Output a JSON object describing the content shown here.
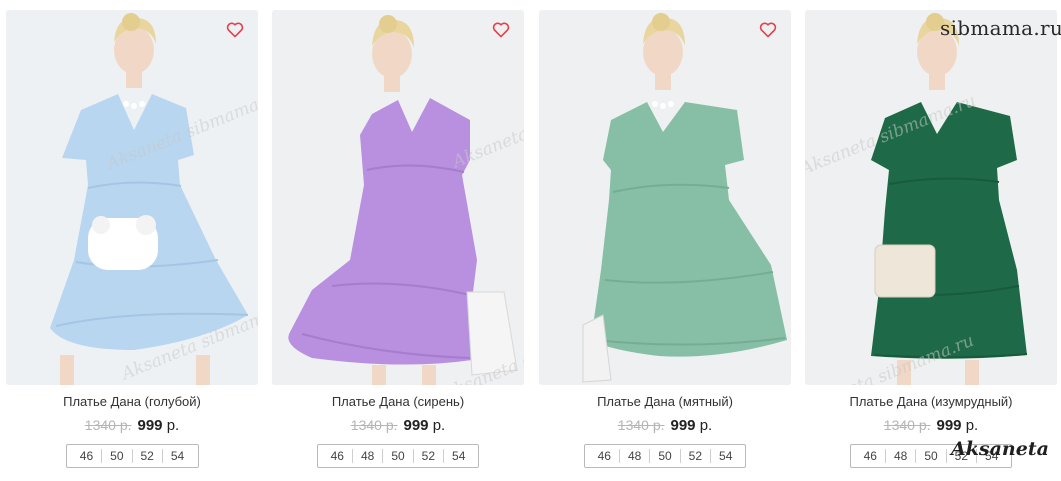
{
  "colors": {
    "heart": "#e2434b",
    "price_old": "#b5b5b5",
    "size_border": "#b9b9b9"
  },
  "watermarks": {
    "site": "sibmama.ru",
    "signature": "Aksaneta",
    "diagonal": "Aksaneta sibmama.ru"
  },
  "products": [
    {
      "title": "Платье Дана (голубой)",
      "old_price": "1340 р.",
      "price": "999",
      "currency": "р.",
      "sizes": [
        "46",
        "50",
        "52",
        "54"
      ],
      "dress_color": "#b8d6f0",
      "bg": "#eef1f4",
      "favorite_icon": "heart-icon"
    },
    {
      "title": "Платье Дана (сирень)",
      "old_price": "1340 р.",
      "price": "999",
      "currency": "р.",
      "sizes": [
        "46",
        "48",
        "50",
        "52",
        "54"
      ],
      "dress_color": "#b98fe0",
      "bg": "#eef0f2",
      "favorite_icon": "heart-icon"
    },
    {
      "title": "Платье Дана (мятный)",
      "old_price": "1340 р.",
      "price": "999",
      "currency": "р.",
      "sizes": [
        "46",
        "48",
        "50",
        "52",
        "54"
      ],
      "dress_color": "#86bfa6",
      "bg": "#eef0f1",
      "favorite_icon": "heart-icon"
    },
    {
      "title": "Платье Дана (изумрудный)",
      "old_price": "1340 р.",
      "price": "999",
      "currency": "р.",
      "sizes": [
        "46",
        "48",
        "50",
        "52",
        "54"
      ],
      "dress_color": "#1e6a48",
      "bg": "#eef0f1",
      "favorite_icon": "heart-icon"
    }
  ]
}
